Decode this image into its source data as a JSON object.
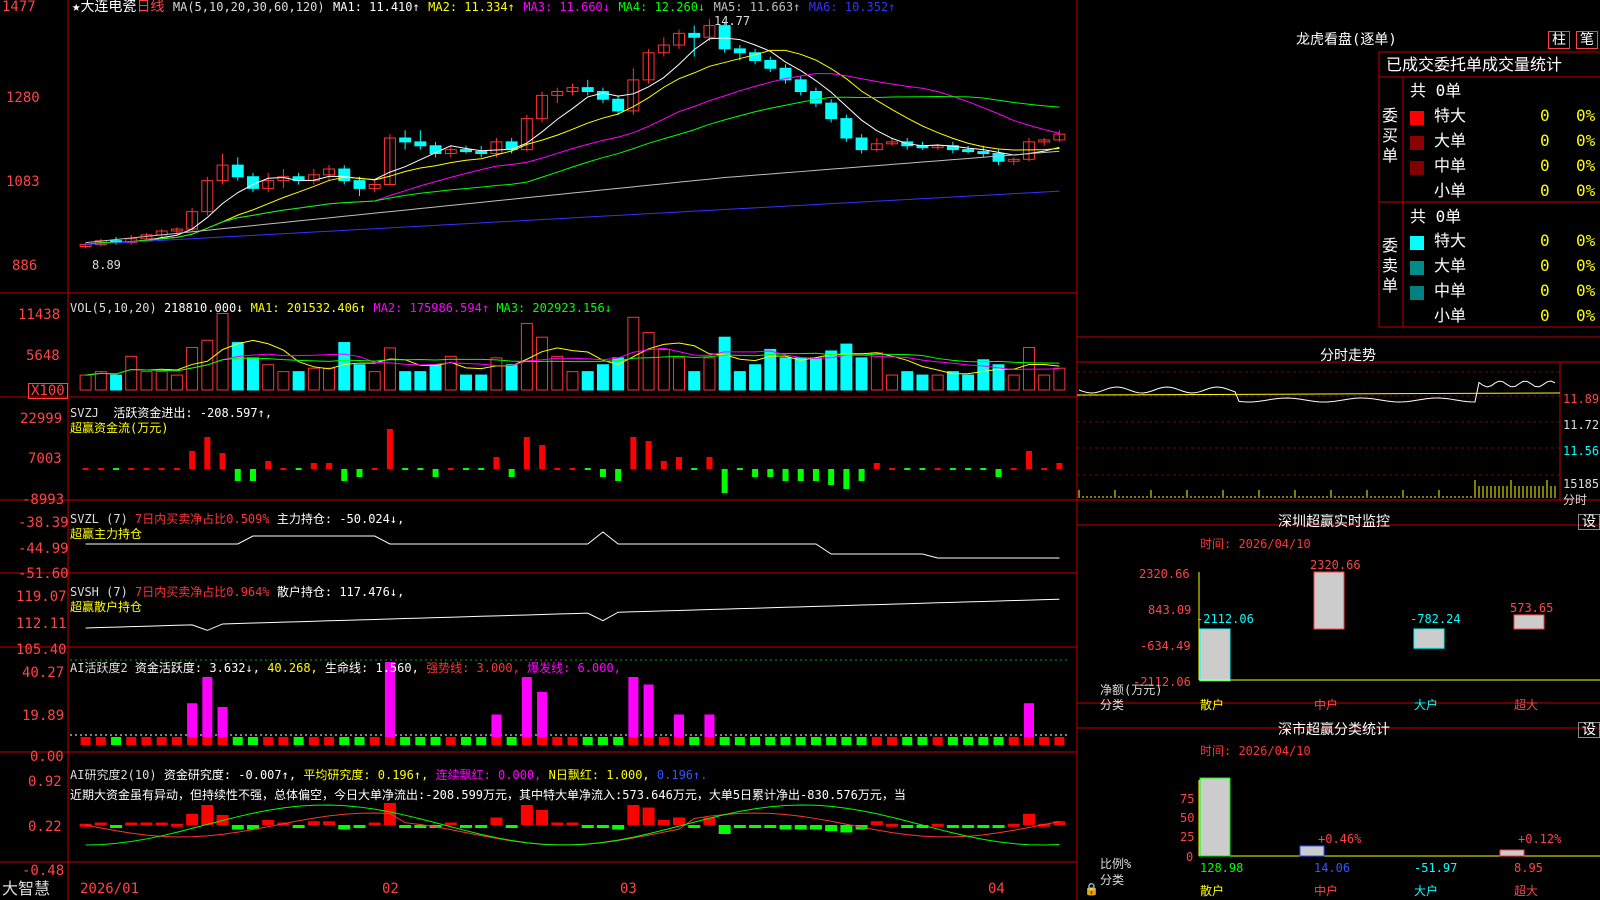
{
  "stock": {
    "star": "★",
    "name": "大连电瓷",
    "period": "日线"
  },
  "ma_header": {
    "text": "MA(5,10,20,30,60,120)",
    "ma1": "MA1: 11.410↑",
    "ma2": "MA2: 11.334↑",
    "ma3": "MA3: 11.660↓",
    "ma4": "MA4: 12.260↓",
    "ma5": "MA5: 11.663↑",
    "ma6": "MA6: 10.352↑",
    "colors": {
      "ma1": "#ffffff",
      "ma2": "#ffff00",
      "ma3": "#ff00ff",
      "ma4": "#00ff00",
      "ma5": "#c0c0c0",
      "ma6": "#3333ff"
    }
  },
  "price_axis": [
    "1477",
    "1280",
    "1083",
    "886"
  ],
  "price_high_label": "14.77",
  "price_low_label": "8.89",
  "vol_header": {
    "title": "VOL(5,10,20)",
    "value": "218810.000↓",
    "ma1": "MA1: 201532.406↑",
    "ma2": "MA2: 175986.594↑",
    "ma3": "MA3: 202923.156↓"
  },
  "vol_axis": [
    "11438",
    "5648",
    "X100"
  ],
  "svzj_header": {
    "title": "SVZJ",
    "label": "活跃资金进出:",
    "value": "-208.597↑,",
    "sub": "超赢资金流(万元)"
  },
  "svzj_axis": [
    "22999",
    "7003",
    "-8993"
  ],
  "svzl_header": {
    "title": "SVZL (7)",
    "mid": "7日内买卖净占比0.509%",
    "label": "主力持仓:",
    "value": "-50.024↓,",
    "sub": "超赢主力持仓"
  },
  "svzl_axis": [
    "-38.39",
    "-44.99",
    "-51.60"
  ],
  "svsh_header": {
    "title": "SVSH (7)",
    "mid": "7日内买卖净占比0.964%",
    "label": "散户持仓:",
    "value": "117.476↓,",
    "sub": "超赢散户持仓"
  },
  "svsh_axis": [
    "119.07",
    "112.11",
    "105.40"
  ],
  "ai_act_header": {
    "title": "AI活跃度2",
    "label": "资金活跃度:",
    "value": "3.632↓,",
    "v2": "40.268,",
    "life": "生命线: 1.560,",
    "strong": "强势线: 3.000,",
    "burst": "爆发线: 6.000,"
  },
  "ai_act_axis": [
    "40.27",
    "19.89",
    "0.00"
  ],
  "ai_res_header": {
    "title": "AI研究度2(10)",
    "label": "资金研究度:",
    "value": "-0.007↑,",
    "avg": "平均研究度: 0.196↑,",
    "red": "连续飘红: 0.000,",
    "nred": "N日飘红: 1.000,",
    "v4": "0.196↑."
  },
  "ai_res_note": "近期大资金虽有异动，但持续性不强，总体偏空，今日大单净流出:-208.599万元，其中特大单净流入:573.646万元，大单5日累计净出-830.576万元，当",
  "ai_res_axis": [
    "0.92",
    "0.22",
    "-0.48"
  ],
  "date_axis": {
    "logo": "大智慧",
    "labels": [
      "2026/01",
      "02",
      "03",
      "04"
    ]
  },
  "dragon": {
    "title": "龙虎看盘(逐单)",
    "btn1": "柱",
    "btn2": "笔",
    "header": "已成交委托单成交量统计",
    "buy": {
      "side": "委买单",
      "total": "共 0单",
      "rows": [
        {
          "name": "特大",
          "vol": "0",
          "pct": "0%",
          "color": "#ff0000"
        },
        {
          "name": "大单",
          "vol": "0",
          "pct": "0%",
          "color": "#8b0000"
        },
        {
          "name": "中单",
          "vol": "0",
          "pct": "0%",
          "color": "#800000"
        },
        {
          "name": "小单",
          "vol": "0",
          "pct": "0%",
          "color": "#000000"
        }
      ]
    },
    "sell": {
      "side": "委卖单",
      "total": "共 0单",
      "rows": [
        {
          "name": "特大",
          "vol": "0",
          "pct": "0%",
          "color": "#00ffff"
        },
        {
          "name": "大单",
          "vol": "0",
          "pct": "0%",
          "color": "#008b8b"
        },
        {
          "name": "中单",
          "vol": "0",
          "pct": "0%",
          "color": "#008080"
        },
        {
          "name": "小单",
          "vol": "0",
          "pct": "0%",
          "color": "#000000"
        }
      ]
    }
  },
  "intraday": {
    "title": "分时走势",
    "axis": [
      "11.89",
      "11.72",
      "11.56",
      "15185",
      "分时"
    ]
  },
  "monitor": {
    "title": "深圳超赢实时监控",
    "btn": "设",
    "time": "时间: 2026/04/10",
    "axis": [
      "2320.66",
      "843.09",
      "-634.49",
      "-2112.06"
    ],
    "ylab": "净额(万元)",
    "xlab": "分类",
    "cats": [
      "散户",
      "中户",
      "大户",
      "超大"
    ],
    "values": [
      -2112.06,
      2320.66,
      -782.24,
      573.65
    ],
    "value_labels": [
      "-2112.06",
      "2320.66",
      "-782.24",
      "573.65"
    ]
  },
  "classify": {
    "title": "深市超赢分类统计",
    "btn": "设",
    "time": "时间: 2026/04/10",
    "axis": [
      "75",
      "50",
      "25",
      "0"
    ],
    "ylab": "比例%",
    "xlab": "分类",
    "cats": [
      "散户",
      "中户",
      "大户",
      "超大"
    ],
    "bottom": [
      "128.98",
      "14.06",
      "-51.97",
      "8.95"
    ],
    "pct_labels": [
      "",
      "+0.46%",
      "",
      "+0.12%"
    ]
  },
  "chart_data": [
    {
      "type": "candlestick",
      "title": "大连电瓷 日线",
      "xlabel": "",
      "ylabel": "",
      "x": [
        "2026/01",
        "02",
        "03",
        "04"
      ],
      "ylim": [
        8.5,
        14.9
      ],
      "series": [
        {
          "name": "K",
          "values": [
            [
              8.9,
              8.95,
              8.85,
              9.0
            ],
            [
              8.95,
              9.05,
              8.9,
              9.1
            ],
            [
              9.05,
              9.0,
              8.95,
              9.15
            ],
            [
              9.0,
              9.1,
              8.95,
              9.2
            ],
            [
              9.1,
              9.2,
              9.05,
              9.25
            ],
            [
              9.2,
              9.3,
              9.1,
              9.35
            ],
            [
              9.3,
              9.35,
              9.2,
              9.4
            ],
            [
              9.35,
              9.8,
              9.3,
              9.9
            ],
            [
              9.8,
              10.6,
              9.7,
              10.7
            ],
            [
              10.6,
              11.0,
              10.5,
              11.3
            ],
            [
              11.0,
              10.7,
              10.6,
              11.2
            ],
            [
              10.7,
              10.4,
              10.3,
              10.8
            ],
            [
              10.4,
              10.6,
              10.3,
              10.8
            ],
            [
              10.6,
              10.7,
              10.4,
              10.9
            ],
            [
              10.7,
              10.6,
              10.5,
              10.8
            ],
            [
              10.6,
              10.75,
              10.5,
              10.9
            ],
            [
              10.75,
              10.9,
              10.6,
              11.0
            ],
            [
              10.9,
              10.6,
              10.5,
              11.0
            ],
            [
              10.6,
              10.4,
              10.2,
              10.7
            ],
            [
              10.4,
              10.5,
              10.3,
              10.6
            ],
            [
              10.5,
              11.7,
              10.5,
              11.8
            ],
            [
              11.7,
              11.6,
              11.4,
              11.9
            ],
            [
              11.6,
              11.5,
              11.4,
              11.9
            ],
            [
              11.5,
              11.3,
              11.2,
              11.6
            ],
            [
              11.3,
              11.4,
              11.2,
              11.5
            ],
            [
              11.4,
              11.35,
              11.3,
              11.5
            ],
            [
              11.35,
              11.3,
              11.2,
              11.5
            ],
            [
              11.3,
              11.6,
              11.2,
              11.7
            ],
            [
              11.6,
              11.4,
              11.3,
              11.7
            ],
            [
              11.4,
              12.2,
              11.35,
              12.3
            ],
            [
              12.2,
              12.8,
              12.1,
              12.9
            ],
            [
              12.8,
              12.9,
              12.6,
              13.0
            ],
            [
              12.9,
              13.0,
              12.8,
              13.1
            ],
            [
              13.0,
              12.9,
              12.8,
              13.2
            ],
            [
              12.9,
              12.7,
              12.6,
              13.0
            ],
            [
              12.7,
              12.4,
              12.3,
              12.8
            ],
            [
              12.4,
              13.2,
              12.3,
              13.5
            ],
            [
              13.2,
              13.9,
              13.1,
              14.0
            ],
            [
              13.9,
              14.1,
              13.8,
              14.3
            ],
            [
              14.1,
              14.4,
              14.0,
              14.5
            ],
            [
              14.4,
              14.3,
              13.8,
              14.6
            ],
            [
              14.3,
              14.6,
              14.2,
              14.77
            ],
            [
              14.6,
              14.0,
              13.9,
              14.7
            ],
            [
              14.0,
              13.9,
              13.7,
              14.1
            ],
            [
              13.9,
              13.7,
              13.6,
              14.0
            ],
            [
              13.7,
              13.5,
              13.4,
              13.8
            ],
            [
              13.5,
              13.2,
              13.1,
              13.6
            ],
            [
              13.2,
              12.9,
              12.8,
              13.3
            ],
            [
              12.9,
              12.6,
              12.5,
              13.0
            ],
            [
              12.6,
              12.2,
              12.1,
              12.7
            ],
            [
              12.2,
              11.7,
              11.6,
              12.3
            ],
            [
              11.7,
              11.4,
              11.3,
              11.8
            ],
            [
              11.4,
              11.55,
              11.35,
              11.7
            ],
            [
              11.55,
              11.6,
              11.5,
              11.7
            ],
            [
              11.6,
              11.5,
              11.4,
              11.7
            ],
            [
              11.5,
              11.45,
              11.4,
              11.6
            ],
            [
              11.45,
              11.5,
              11.4,
              11.55
            ],
            [
              11.5,
              11.4,
              11.3,
              11.6
            ],
            [
              11.4,
              11.35,
              11.3,
              11.5
            ],
            [
              11.35,
              11.3,
              11.2,
              11.5
            ],
            [
              11.3,
              11.1,
              11.0,
              11.4
            ],
            [
              11.1,
              11.15,
              11.0,
              11.2
            ],
            [
              11.15,
              11.6,
              11.1,
              11.7
            ],
            [
              11.6,
              11.65,
              11.5,
              11.7
            ],
            [
              11.65,
              11.8,
              11.6,
              11.9
            ]
          ]
        }
      ]
    }
  ]
}
